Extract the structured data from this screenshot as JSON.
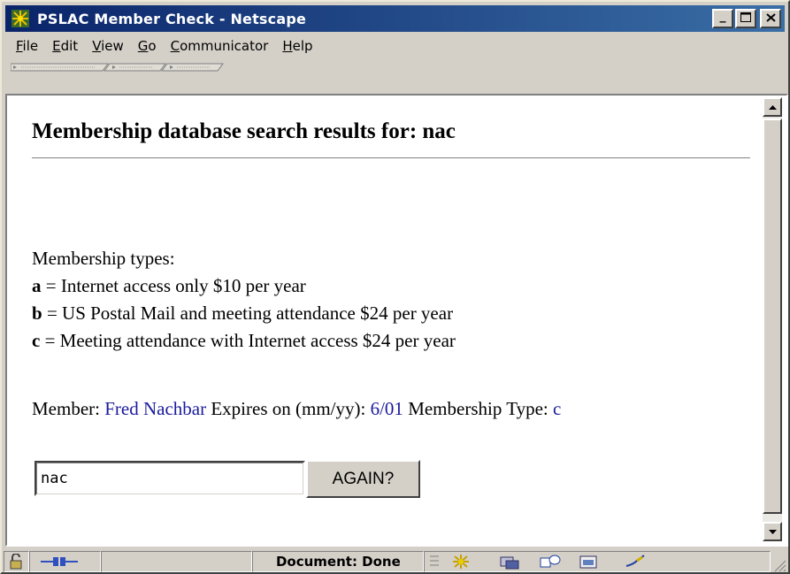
{
  "window": {
    "title": "PSLAC Member Check - Netscape",
    "minimize_glyph": "_",
    "maximize_glyph": "□",
    "close_glyph": "✕"
  },
  "menu": [
    {
      "key": "F",
      "rest": "ile"
    },
    {
      "key": "E",
      "rest": "dit"
    },
    {
      "key": "V",
      "rest": "iew"
    },
    {
      "key": "G",
      "rest": "o"
    },
    {
      "key": "C",
      "rest": "ommunicator"
    },
    {
      "key": "H",
      "rest": "elp"
    }
  ],
  "page": {
    "heading": "Membership database search results for: nac",
    "types_title": "Membership types:",
    "types": [
      {
        "code": "a",
        "text": " = Internet access only $10 per year"
      },
      {
        "code": "b",
        "text": " = US Postal Mail and meeting attendance $24 per year"
      },
      {
        "code": "c",
        "text": " = Meeting attendance with Internet access $24 per year"
      }
    ],
    "member": {
      "label": "Member: ",
      "name": "Fred Nachbar",
      "expires_label": " Expires on (mm/yy): ",
      "expires": "6/01",
      "type_label": " Membership Type: ",
      "type": "c"
    },
    "search": {
      "value": "nac",
      "button_label": "AGAIN?"
    }
  },
  "status": {
    "text": "Document: Done",
    "icons": [
      "security-lock-icon",
      "connection-icon",
      "navigator-icon",
      "mail-icon",
      "discussions-icon",
      "composer-icon",
      "edit-icon"
    ]
  },
  "colors": {
    "titlebar_start": "#0a246a",
    "titlebar_end": "#3a6ea5",
    "link": "#1a1a9e",
    "chrome": "#d4d0c8"
  }
}
